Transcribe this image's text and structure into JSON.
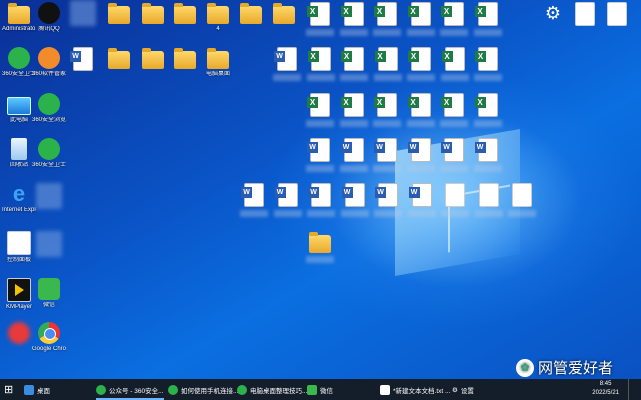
{
  "desktop": {
    "icons": [
      {
        "type": "folder",
        "label": "Administrato...",
        "blurred": true
      },
      {
        "type": "qq",
        "label": "腾讯QQ",
        "blurred": true
      },
      {
        "type": "blur",
        "label": ""
      },
      {
        "type": "folder",
        "label": ""
      },
      {
        "type": "folder",
        "label": ""
      },
      {
        "type": "folder",
        "label": ""
      },
      {
        "type": "folder",
        "label": "4"
      },
      {
        "type": "folder",
        "label": ""
      },
      {
        "type": "folder",
        "label": ""
      },
      {
        "type": "green",
        "label": "360安全卫士",
        "blurred": true
      },
      {
        "type": "orange",
        "label": "360软件管家",
        "blurred": true
      },
      {
        "type": "blur",
        "label": ""
      },
      {
        "type": "folder",
        "label": ""
      },
      {
        "type": "folder",
        "label": ""
      },
      {
        "type": "folder",
        "label": ""
      },
      {
        "type": "folder",
        "label": "电脑桌面"
      },
      {
        "type": "pc",
        "label": "此电脑"
      },
      {
        "type": "green",
        "label": "360安全浏览器"
      },
      {
        "type": "bin",
        "label": "回收站"
      },
      {
        "type": "green",
        "label": "360安全卫士"
      },
      {
        "type": "ie",
        "label": "Internet Explorer"
      },
      {
        "type": "blur",
        "label": ""
      },
      {
        "type": "tool",
        "label": "控制面板"
      },
      {
        "type": "blur",
        "label": ""
      },
      {
        "type": "player",
        "label": "KMPlayer"
      },
      {
        "type": "wechat",
        "label": "微信"
      },
      {
        "type": "red",
        "label": ""
      },
      {
        "type": "chrome",
        "label": "Google Chrome"
      }
    ],
    "file_grid_note": ""
  },
  "top_right": {
    "gear_label": "设置",
    "doc_label": ""
  },
  "taskbar": {
    "start_label": "",
    "desktop_label": "桌面",
    "items": [
      {
        "label": "公众号 - 360安全...",
        "icon_color": "#2cb24a"
      },
      {
        "label": "如何使用手机连接...",
        "icon_color": "#2cb24a"
      },
      {
        "label": "电脑桌面整理技巧...",
        "icon_color": "#2cb24a"
      },
      {
        "label": "微信",
        "icon_color": "#3bb84d"
      },
      {
        "label": "*新建文本文档.txt ...",
        "icon_color": "#ffffff"
      },
      {
        "label": "设置",
        "icon_color": "#ffffff"
      }
    ],
    "clock_time": "8:45",
    "clock_date": "2022/5/21"
  },
  "watermark": {
    "text": "网管爱好者"
  },
  "colors": {
    "taskbar": "#141e2b",
    "accent": "#6fb4ff",
    "desktop": "#0a55c8"
  }
}
